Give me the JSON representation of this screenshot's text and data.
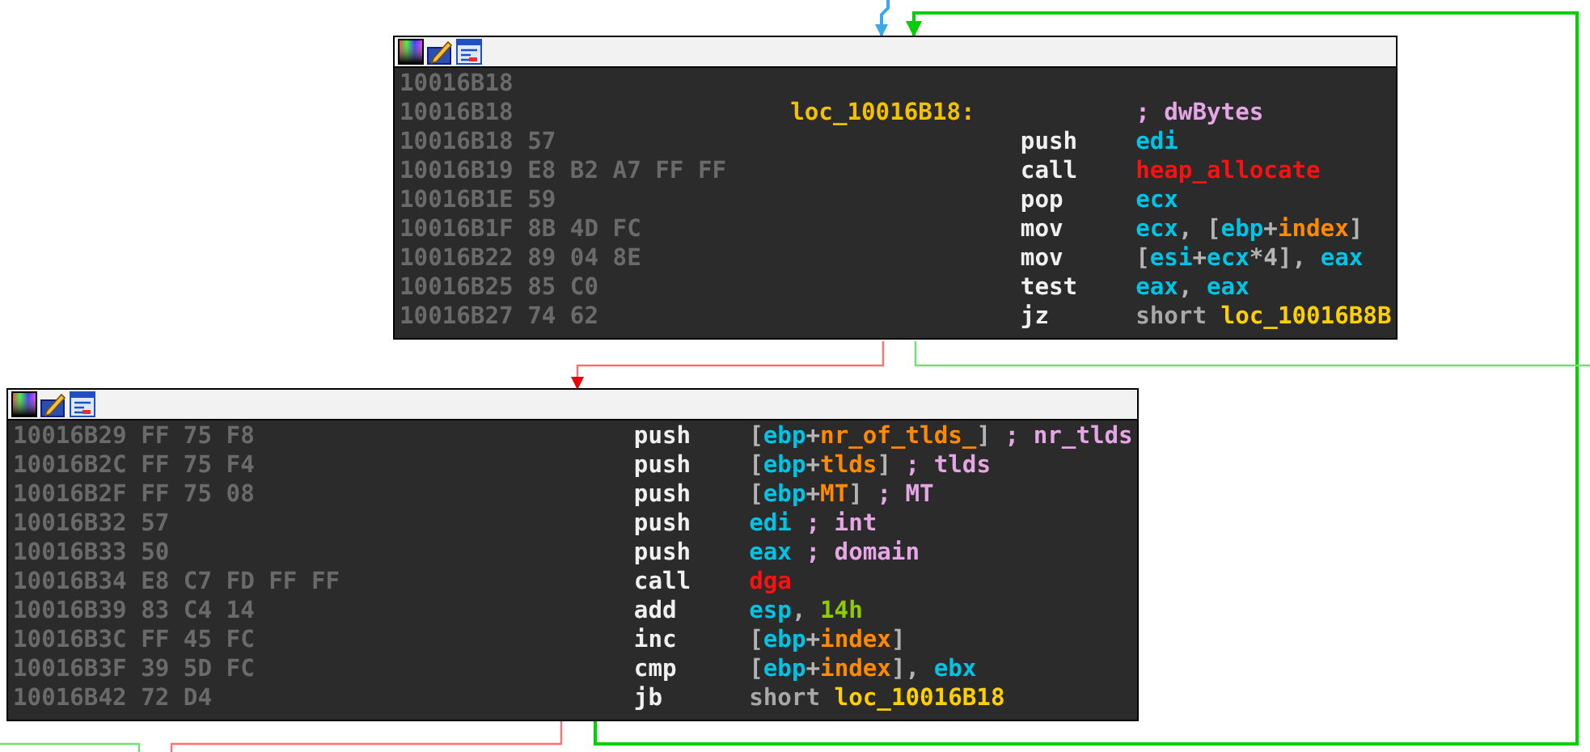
{
  "blocks": [
    {
      "lines": [
        {
          "address": "10016B18"
        },
        {
          "address": "10016B18",
          "label": "loc_10016B18:",
          "comment": "; dwBytes"
        },
        {
          "address": "10016B18",
          "bytes": "57",
          "mnemonic": "push",
          "operands": [
            {
              "text": "edi",
              "kind": "reg"
            }
          ]
        },
        {
          "address": "10016B19",
          "bytes": "E8 B2 A7 FF FF",
          "mnemonic": "call",
          "operands": [
            {
              "text": "heap_allocate",
              "kind": "func"
            }
          ]
        },
        {
          "address": "10016B1E",
          "bytes": "59",
          "mnemonic": "pop",
          "operands": [
            {
              "text": "ecx",
              "kind": "reg"
            }
          ]
        },
        {
          "address": "10016B1F",
          "bytes": "8B 4D FC",
          "mnemonic": "mov",
          "operands": [
            {
              "text": "ecx",
              "kind": "reg"
            },
            {
              "text": ", [",
              "kind": "punct"
            },
            {
              "text": "ebp",
              "kind": "reg"
            },
            {
              "text": "+",
              "kind": "punct"
            },
            {
              "text": "index",
              "kind": "var"
            },
            {
              "text": "]",
              "kind": "punct"
            }
          ]
        },
        {
          "address": "10016B22",
          "bytes": "89 04 8E",
          "mnemonic": "mov",
          "operands": [
            {
              "text": "[",
              "kind": "punct"
            },
            {
              "text": "esi",
              "kind": "reg"
            },
            {
              "text": "+",
              "kind": "punct"
            },
            {
              "text": "ecx",
              "kind": "reg"
            },
            {
              "text": "*4], ",
              "kind": "punct"
            },
            {
              "text": "eax",
              "kind": "reg"
            }
          ]
        },
        {
          "address": "10016B25",
          "bytes": "85 C0",
          "mnemonic": "test",
          "operands": [
            {
              "text": "eax",
              "kind": "reg"
            },
            {
              "text": ", ",
              "kind": "punct"
            },
            {
              "text": "eax",
              "kind": "reg"
            }
          ]
        },
        {
          "address": "10016B27",
          "bytes": "74 62",
          "mnemonic": "jz",
          "operands": [
            {
              "text": "short ",
              "kind": "keyword"
            },
            {
              "text": "loc_10016B8B",
              "kind": "loc"
            }
          ]
        }
      ]
    },
    {
      "lines": [
        {
          "address": "10016B29",
          "bytes": "FF 75 F8",
          "mnemonic": "push",
          "operands": [
            {
              "text": "[",
              "kind": "punct"
            },
            {
              "text": "ebp",
              "kind": "reg"
            },
            {
              "text": "+",
              "kind": "punct"
            },
            {
              "text": "nr_of_tlds_",
              "kind": "var"
            },
            {
              "text": "]",
              "kind": "punct"
            }
          ],
          "comment": "; nr_tlds"
        },
        {
          "address": "10016B2C",
          "bytes": "FF 75 F4",
          "mnemonic": "push",
          "operands": [
            {
              "text": "[",
              "kind": "punct"
            },
            {
              "text": "ebp",
              "kind": "reg"
            },
            {
              "text": "+",
              "kind": "punct"
            },
            {
              "text": "tlds",
              "kind": "var"
            },
            {
              "text": "]",
              "kind": "punct"
            }
          ],
          "comment": "; tlds"
        },
        {
          "address": "10016B2F",
          "bytes": "FF 75 08",
          "mnemonic": "push",
          "operands": [
            {
              "text": "[",
              "kind": "punct"
            },
            {
              "text": "ebp",
              "kind": "reg"
            },
            {
              "text": "+",
              "kind": "punct"
            },
            {
              "text": "MT",
              "kind": "var"
            },
            {
              "text": "]",
              "kind": "punct"
            }
          ],
          "comment": "; MT"
        },
        {
          "address": "10016B32",
          "bytes": "57",
          "mnemonic": "push",
          "operands": [
            {
              "text": "edi",
              "kind": "reg"
            }
          ],
          "comment": "; int"
        },
        {
          "address": "10016B33",
          "bytes": "50",
          "mnemonic": "push",
          "operands": [
            {
              "text": "eax",
              "kind": "reg"
            }
          ],
          "comment": "; domain"
        },
        {
          "address": "10016B34",
          "bytes": "E8 C7 FD FF FF",
          "mnemonic": "call",
          "operands": [
            {
              "text": "dga",
              "kind": "func"
            }
          ]
        },
        {
          "address": "10016B39",
          "bytes": "83 C4 14",
          "mnemonic": "add",
          "operands": [
            {
              "text": "esp",
              "kind": "reg"
            },
            {
              "text": ", ",
              "kind": "punct"
            },
            {
              "text": "14h",
              "kind": "num"
            }
          ]
        },
        {
          "address": "10016B3C",
          "bytes": "FF 45 FC",
          "mnemonic": "inc",
          "operands": [
            {
              "text": "[",
              "kind": "punct"
            },
            {
              "text": "ebp",
              "kind": "reg"
            },
            {
              "text": "+",
              "kind": "punct"
            },
            {
              "text": "index",
              "kind": "var"
            },
            {
              "text": "]",
              "kind": "punct"
            }
          ]
        },
        {
          "address": "10016B3F",
          "bytes": "39 5D FC",
          "mnemonic": "cmp",
          "operands": [
            {
              "text": "[",
              "kind": "punct"
            },
            {
              "text": "ebp",
              "kind": "reg"
            },
            {
              "text": "+",
              "kind": "punct"
            },
            {
              "text": "index",
              "kind": "var"
            },
            {
              "text": "], ",
              "kind": "punct"
            },
            {
              "text": "ebx",
              "kind": "reg"
            }
          ]
        },
        {
          "address": "10016B42",
          "bytes": "72 D4",
          "mnemonic": "jb",
          "operands": [
            {
              "text": "short ",
              "kind": "keyword"
            },
            {
              "text": "loc_10016B18",
              "kind": "loc"
            }
          ]
        }
      ]
    }
  ]
}
